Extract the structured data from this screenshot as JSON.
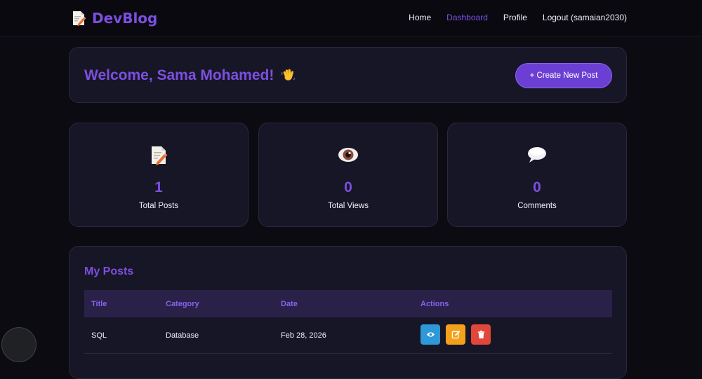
{
  "brand": {
    "name": "DevBlog",
    "icon": "memo-icon"
  },
  "nav": {
    "home": "Home",
    "dashboard": "Dashboard",
    "profile": "Profile",
    "logout": "Logout (samaian2030)"
  },
  "welcome": {
    "title": "Welcome, Sama Mohamed!",
    "icon": "waving-hand-icon",
    "create_button": "+ Create New Post"
  },
  "stats": [
    {
      "icon": "memo-icon",
      "value": "1",
      "label": "Total Posts"
    },
    {
      "icon": "eye-icon",
      "value": "0",
      "label": "Total Views"
    },
    {
      "icon": "speech-bubble-icon",
      "value": "0",
      "label": "Comments"
    }
  ],
  "posts": {
    "title": "My Posts",
    "columns": [
      "Title",
      "Category",
      "Date",
      "Actions"
    ],
    "rows": [
      {
        "title": "SQL",
        "category": "Database",
        "date": "Feb 28, 2026"
      }
    ]
  },
  "colors": {
    "accent": "#7c4fe0",
    "background": "#0c0b12",
    "card": "#171626",
    "view": "#2f98d6",
    "edit": "#f3a11a",
    "delete": "#e0463a"
  }
}
